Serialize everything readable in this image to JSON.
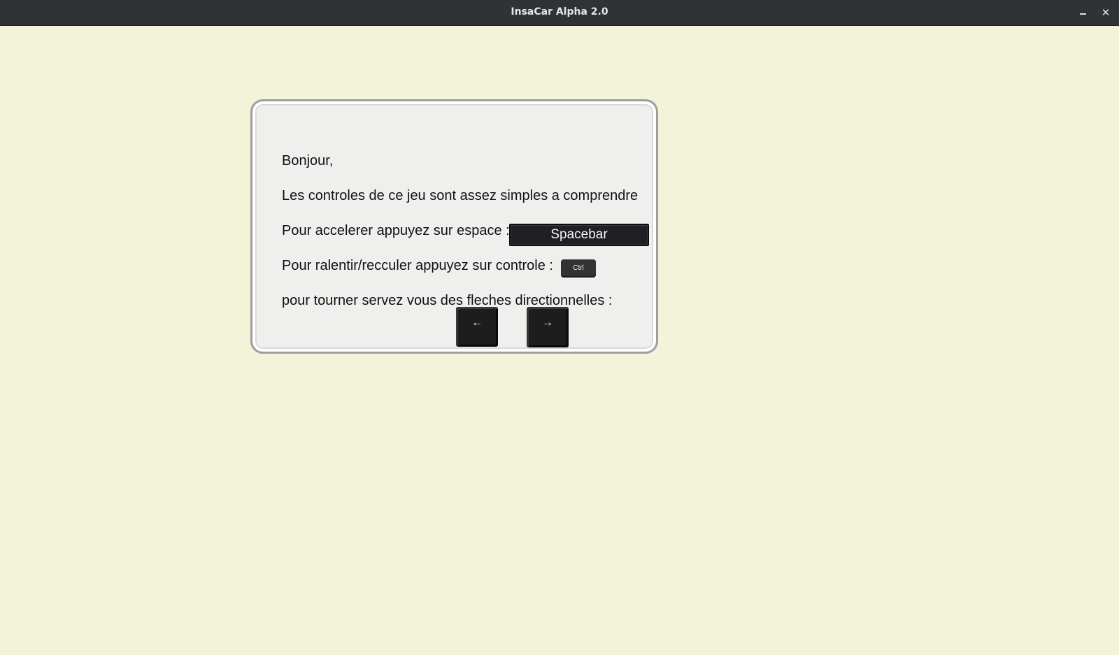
{
  "window": {
    "title": "InsaCar Alpha 2.0",
    "minimize_icon": "minimize-icon",
    "close_label": "✕"
  },
  "instructions": {
    "greeting": "Bonjour,",
    "intro": "Les controles de ce jeu sont assez simples a comprendre",
    "accelerate": "Pour accelerer appuyez sur espace :",
    "brake": "Pour ralentir/recculer appuyez sur controle :",
    "turn": "pour tourner servez vous des fleches directionnelles :"
  },
  "keys": {
    "spacebar": "Spacebar",
    "ctrl": "Ctrl",
    "left_arrow": "←",
    "right_arrow": "→"
  },
  "colors": {
    "background": "#f3f3da",
    "titlebar": "#2f3335",
    "panel": "#efefee",
    "key": "#1f2026"
  }
}
